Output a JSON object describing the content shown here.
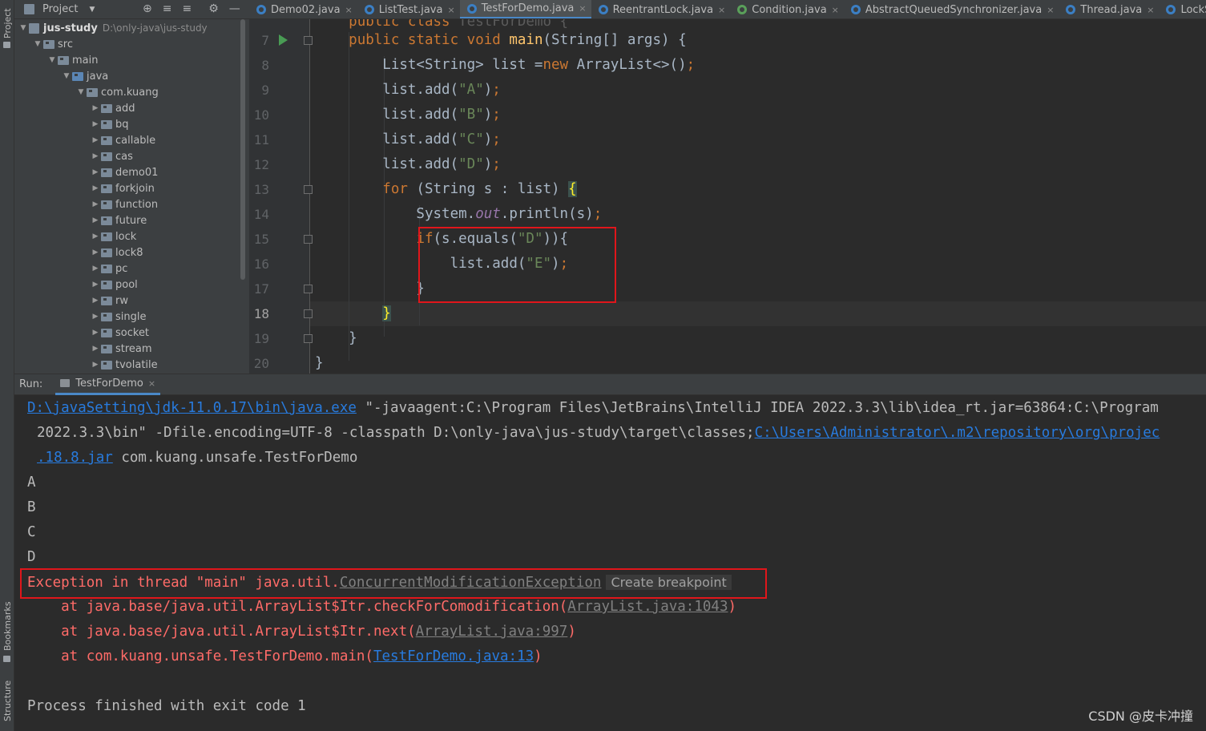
{
  "left_strip": {
    "project_tab": "Project",
    "bookmarks_tab": "Bookmarks",
    "structure_tab": "Structure"
  },
  "project_panel": {
    "title": "Project",
    "root": {
      "name": "jus-study",
      "path": "D:\\only-java\\jus-study"
    },
    "src": "src",
    "main": "main",
    "java": "java",
    "package": "com.kuang",
    "folders": [
      "add",
      "bq",
      "callable",
      "cas",
      "demo01",
      "forkjoin",
      "function",
      "future",
      "lock",
      "lock8",
      "pc",
      "pool",
      "rw",
      "single",
      "socket",
      "stream",
      "tvolatile"
    ]
  },
  "editor_tabs": [
    {
      "label": "Demo02.java",
      "icon": "class-icon",
      "active": false
    },
    {
      "label": "ListTest.java",
      "icon": "class-icon",
      "active": false
    },
    {
      "label": "TestForDemo.java",
      "icon": "class-icon",
      "active": true
    },
    {
      "label": "ReentrantLock.java",
      "icon": "class-icon",
      "active": false
    },
    {
      "label": "Condition.java",
      "icon": "interface-icon",
      "active": false
    },
    {
      "label": "AbstractQueuedSynchronizer.java",
      "icon": "class-icon",
      "active": false
    },
    {
      "label": "Thread.java",
      "icon": "class-icon",
      "active": false
    },
    {
      "label": "LockSupport.java",
      "icon": "class-icon",
      "active": false
    }
  ],
  "editor": {
    "line_numbers": [
      "7",
      "8",
      "9",
      "10",
      "11",
      "12",
      "13",
      "14",
      "15",
      "16",
      "17",
      "18",
      "19",
      "20"
    ],
    "current_line": "18"
  },
  "run_panel": {
    "label": "Run:",
    "tab": "TestForDemo",
    "console": {
      "cmd_path_link": "D:\\javaSetting\\jdk-11.0.17\\bin\\java.exe",
      "cmd_line1_rest": " \"-javaagent:C:\\Program Files\\JetBrains\\IntelliJ IDEA 2022.3.3\\lib\\idea_rt.jar=63864:C:\\Program",
      "cmd_line2_text": "2022.3.3\\bin\" -Dfile.encoding=UTF-8 -classpath D:\\only-java\\jus-study\\target\\classes;",
      "cmd_line2_link": "C:\\Users\\Administrator\\.m2\\repository\\org\\projec",
      "cmd_line3_link": ".18.8.jar",
      "cmd_line3_rest": " com.kuang.unsafe.TestForDemo",
      "outputs": [
        "A",
        "B",
        "C",
        "D"
      ],
      "exception_prefix": "Exception in thread \"main\" java.util.",
      "exception_class": "ConcurrentModificationException",
      "breakpoint_hint": "Create breakpoint",
      "stack": [
        {
          "prefix": "    at java.base/java.util.ArrayList$Itr.checkForComodification(",
          "link": "ArrayList.java:1043",
          "suffix": ")"
        },
        {
          "prefix": "    at java.base/java.util.ArrayList$Itr.next(",
          "link": "ArrayList.java:997",
          "suffix": ")"
        },
        {
          "prefix": "    at com.kuang.unsafe.TestForDemo.main(",
          "link": "TestForDemo.java:13",
          "suffix": ")"
        }
      ],
      "exit_message": "Process finished with exit code 1"
    }
  },
  "watermark": "CSDN @皮卡冲撞",
  "colors": {
    "keyword": "#cc7832",
    "string": "#6a8759",
    "method": "#ffc66d",
    "error": "#ff6b68",
    "link": "#287bde",
    "highlight_box": "#e0161b"
  }
}
